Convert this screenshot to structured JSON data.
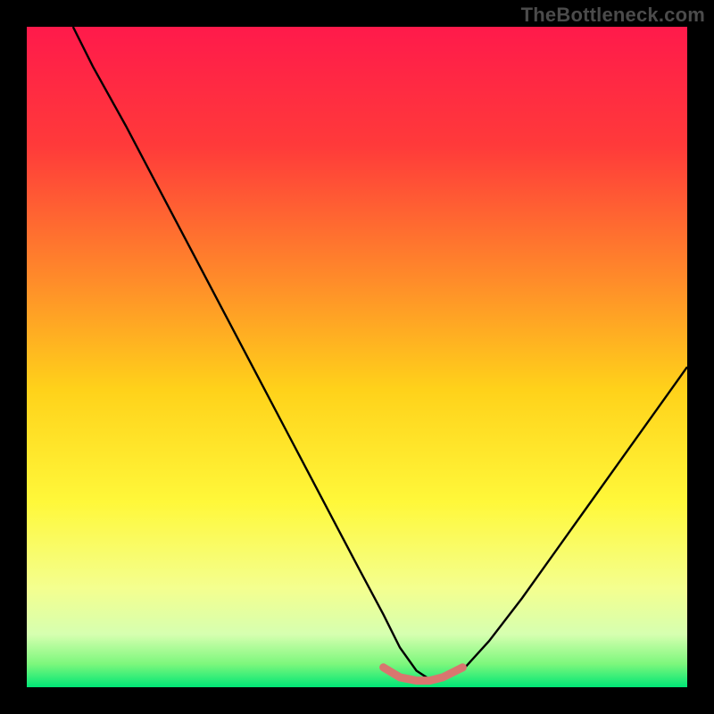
{
  "watermark": "TheBottleneck.com",
  "colors": {
    "frame_bg": "#000000",
    "gradient_stops": [
      {
        "offset": 0.0,
        "color": "#ff1a4b"
      },
      {
        "offset": 0.18,
        "color": "#ff3a3a"
      },
      {
        "offset": 0.38,
        "color": "#ff8a2a"
      },
      {
        "offset": 0.55,
        "color": "#ffd21a"
      },
      {
        "offset": 0.72,
        "color": "#fff83a"
      },
      {
        "offset": 0.85,
        "color": "#f4ff8f"
      },
      {
        "offset": 0.92,
        "color": "#d6ffb0"
      },
      {
        "offset": 0.965,
        "color": "#7cf77c"
      },
      {
        "offset": 1.0,
        "color": "#00e676"
      }
    ],
    "curve": "#000000",
    "bottom_marker": "#d9766f"
  },
  "chart_data": {
    "type": "line",
    "title": "",
    "xlabel": "",
    "ylabel": "",
    "xlim": [
      0,
      100
    ],
    "ylim": [
      0,
      100
    ],
    "grid": false,
    "legend": false,
    "series": [
      {
        "name": "bottleneck-curve-main",
        "x": [
          7,
          10,
          15,
          20,
          25,
          30,
          35,
          40,
          45,
          50,
          54,
          56.5,
          59,
          61,
          63,
          66,
          70,
          75,
          80,
          85,
          90,
          95,
          100
        ],
        "values": [
          100,
          94,
          85,
          75.5,
          66,
          56.5,
          47,
          37.5,
          28,
          18.5,
          11,
          6,
          2.5,
          1.2,
          1.2,
          2.6,
          7,
          13.5,
          20.5,
          27.5,
          34.5,
          41.5,
          48.5
        ]
      },
      {
        "name": "bottom-marker-segment",
        "x": [
          54,
          56.5,
          59,
          61,
          63,
          66
        ],
        "values": [
          3.0,
          1.5,
          1.0,
          1.0,
          1.5,
          3.0
        ]
      }
    ]
  }
}
